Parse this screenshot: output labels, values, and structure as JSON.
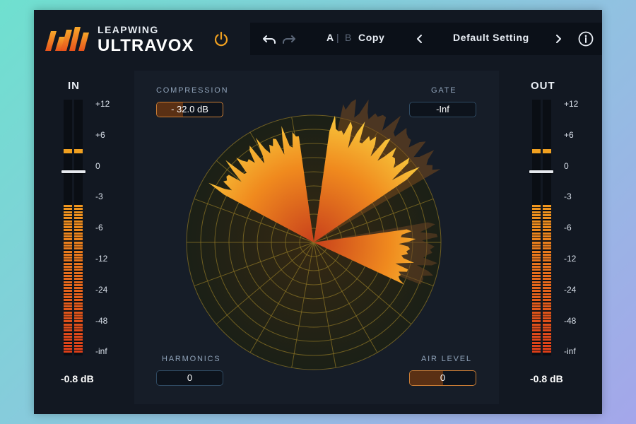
{
  "brand": {
    "company": "LEAPWING",
    "product": "ULTRAVOX"
  },
  "toolbar": {
    "undo_icon": "undo-icon",
    "redo_icon": "redo-icon",
    "a_label": "A",
    "separator": "|",
    "b_label": "B",
    "copy_label": "Copy",
    "preset_name": "Default Setting",
    "info_icon": "info-icon"
  },
  "input_meter": {
    "label": "IN",
    "readout": "-0.8 dB",
    "scale": [
      "+12",
      "+6",
      "0",
      "-3",
      "-6",
      "-12",
      "-24",
      "-48",
      "-inf"
    ]
  },
  "output_meter": {
    "label": "OUT",
    "readout": "-0.8 dB",
    "scale": [
      "+12",
      "+6",
      "0",
      "-3",
      "-6",
      "-12",
      "-24",
      "-48",
      "-inf"
    ]
  },
  "params": {
    "compression": {
      "label": "COMPRESSION",
      "value": "- 32.0 dB",
      "fill": 0.4
    },
    "gate": {
      "label": "GATE",
      "value": "-Inf",
      "fill": 0
    },
    "harmonics": {
      "label": "HARMONICS",
      "value": "0",
      "fill": 0
    },
    "air_level": {
      "label": "AIR LEVEL",
      "value": "0",
      "fill": 0.5
    }
  },
  "colors": {
    "accent": "#f0a020",
    "meter_orange": "#f08a1e",
    "meter_red": "#e0461e",
    "panel": "#121822"
  }
}
